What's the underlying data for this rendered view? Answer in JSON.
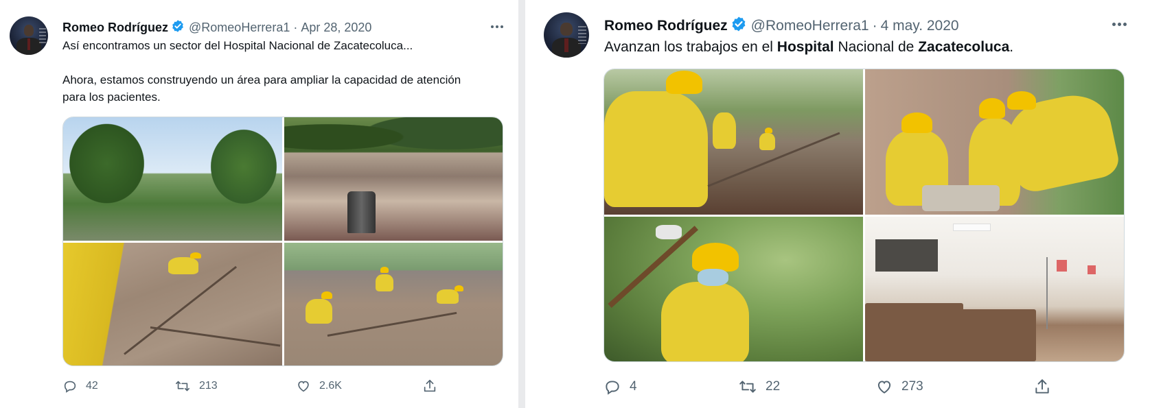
{
  "tweets": [
    {
      "author": {
        "name": "Romeo Rodríguez",
        "handle": "@RomeoHerrera1",
        "verified": true
      },
      "separator": "·",
      "date": "Apr 28, 2020",
      "text_lines": [
        "Así encontramos un sector del Hospital Nacional de Zacatecoluca...",
        "",
        "Ahora, estamos construyendo un área para ampliar la capacidad de atención",
        "para los pacientes."
      ],
      "media_count": 4,
      "stats": {
        "replies": "42",
        "retweets": "213",
        "likes": "2.6K"
      }
    },
    {
      "author": {
        "name": "Romeo Rodríguez",
        "handle": "@RomeoHerrera1",
        "verified": true
      },
      "separator": "·",
      "date": "4 may. 2020",
      "text": {
        "pre": "Avanzan los trabajos en el ",
        "bold1": "Hospital",
        "mid": " Nacional de ",
        "bold2": "Zacatecoluca",
        "post": "."
      },
      "media_count": 4,
      "stats": {
        "replies": "4",
        "retweets": "22",
        "likes": "273"
      }
    }
  ],
  "icons": {
    "verified": "verified-badge-icon",
    "more": "more-options-icon",
    "reply": "reply-icon",
    "retweet": "retweet-icon",
    "like": "heart-icon",
    "share": "share-icon"
  },
  "colors": {
    "verified_blue": "#1d9bf0",
    "text_primary": "#0f1419",
    "text_secondary": "#536471",
    "page_background": "#e9eaec"
  }
}
